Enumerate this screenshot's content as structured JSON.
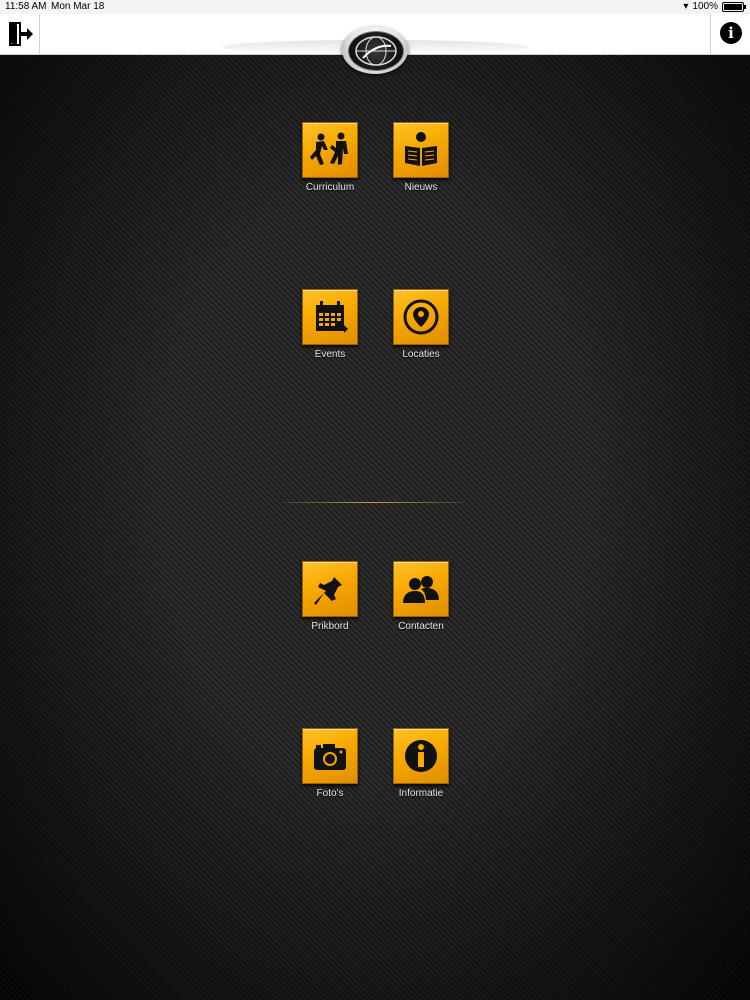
{
  "status_bar": {
    "time": "11:58 AM",
    "date": "Mon Mar 18",
    "battery": "100%"
  },
  "nav": {
    "logout_icon": "logout-icon",
    "info_icon": "info-icon",
    "logo": "club-emblem"
  },
  "menu": {
    "items": [
      {
        "label": "Curriculum",
        "icon": "sparring-figures-icon"
      },
      {
        "label": "Nieuws",
        "icon": "newspaper-reader-icon"
      },
      {
        "label": "Events",
        "icon": "calendar-icon"
      },
      {
        "label": "Locaties",
        "icon": "location-pin-icon"
      },
      {
        "label": "Prikbord",
        "icon": "pushpin-icon"
      },
      {
        "label": "Contacten",
        "icon": "contacts-icon"
      },
      {
        "label": "Foto's",
        "icon": "camera-icon"
      },
      {
        "label": "Informatie",
        "icon": "info-icon"
      }
    ]
  },
  "colors": {
    "tile": "#f7a800",
    "background": "#262626",
    "divider": "#c8a030"
  }
}
